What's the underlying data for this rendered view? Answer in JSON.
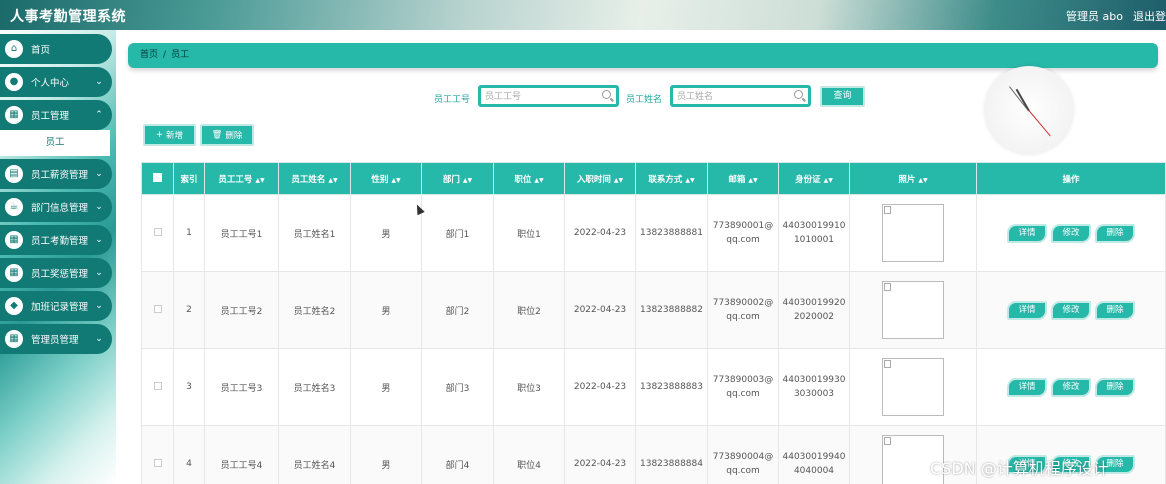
{
  "header": {
    "app_title": "人事考勤管理系统",
    "admin_name": "管理员 abo",
    "logout": "退出登录"
  },
  "sidebar": {
    "items": [
      {
        "label": "首页",
        "icon": "home-icon",
        "has_children": false
      },
      {
        "label": "个人中心",
        "icon": "person-icon",
        "has_children": true
      },
      {
        "label": "员工管理",
        "icon": "grid-icon",
        "has_children": true
      },
      {
        "label": "员工薪资管理",
        "icon": "book-icon",
        "has_children": true
      },
      {
        "label": "部门信息管理",
        "icon": "cup-icon",
        "has_children": true
      },
      {
        "label": "员工考勤管理",
        "icon": "grid-icon",
        "has_children": true
      },
      {
        "label": "员工奖惩管理",
        "icon": "grid-icon",
        "has_children": true
      },
      {
        "label": "加班记录管理",
        "icon": "shield-icon",
        "has_children": true
      },
      {
        "label": "管理员管理",
        "icon": "grid-icon",
        "has_children": true
      }
    ],
    "submenu_active": "员工"
  },
  "breadcrumb": {
    "home": "首页",
    "separator": "/",
    "current": "员工"
  },
  "search": {
    "emp_no_label": "员工工号",
    "emp_no_placeholder": "员工工号",
    "emp_name_label": "员工姓名",
    "emp_name_placeholder": "员工姓名",
    "query_button": "查询"
  },
  "actions": {
    "add": "新增",
    "delete": "删除",
    "add_glyph": "+",
    "delete_glyph": "🗑"
  },
  "table": {
    "headers": [
      "",
      "索引",
      "员工工号",
      "员工姓名",
      "性别",
      "部门",
      "职位",
      "入职时间",
      "联系方式",
      "邮箱",
      "身份证",
      "照片",
      "操作"
    ],
    "row_buttons": {
      "detail": "详情",
      "edit": "修改",
      "delete": "删除"
    },
    "rows": [
      {
        "index": "1",
        "emp_no": "员工工号1",
        "emp_name": "员工姓名1",
        "gender": "男",
        "dept": "部门1",
        "position": "职位1",
        "hire_date": "2022-04-23",
        "phone": "13823888881",
        "email_1": "773890001@",
        "email_2": "qq.com",
        "id_1": "44030019910",
        "id_2": "1010001"
      },
      {
        "index": "2",
        "emp_no": "员工工号2",
        "emp_name": "员工姓名2",
        "gender": "男",
        "dept": "部门2",
        "position": "职位2",
        "hire_date": "2022-04-23",
        "phone": "13823888882",
        "email_1": "773890002@",
        "email_2": "qq.com",
        "id_1": "44030019920",
        "id_2": "2020002"
      },
      {
        "index": "3",
        "emp_no": "员工工号3",
        "emp_name": "员工姓名3",
        "gender": "男",
        "dept": "部门3",
        "position": "职位3",
        "hire_date": "2022-04-23",
        "phone": "13823888883",
        "email_1": "773890003@",
        "email_2": "qq.com",
        "id_1": "44030019930",
        "id_2": "3030003"
      },
      {
        "index": "4",
        "emp_no": "员工工号4",
        "emp_name": "员工姓名4",
        "gender": "男",
        "dept": "部门4",
        "position": "职位4",
        "hire_date": "2022-04-23",
        "phone": "13823888884",
        "email_1": "773890004@",
        "email_2": "qq.com",
        "id_1": "44030019940",
        "id_2": "4040004"
      }
    ]
  },
  "watermark": "CSDN @计算机程序设计",
  "colors": {
    "accent": "#26b8a9",
    "sidebar_item": "#127a74"
  }
}
